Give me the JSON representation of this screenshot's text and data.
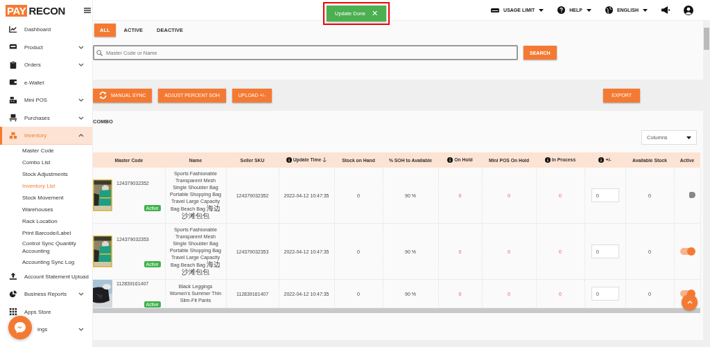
{
  "logo": {
    "part_1": "PAY",
    "part_2": "RECON"
  },
  "toast": {
    "text": "Update Done",
    "close": "✕"
  },
  "topbar": {
    "items": [
      {
        "label": "USAGE LIMIT",
        "kind": "storage"
      },
      {
        "label": "HELP",
        "kind": "help"
      },
      {
        "label": "ENGLISH",
        "kind": "globe"
      }
    ]
  },
  "sidebar": {
    "items": [
      {
        "label": "Dashboard",
        "expandable": false,
        "expanded": false,
        "selected": false
      },
      {
        "label": "Product",
        "expandable": true,
        "expanded": false,
        "selected": false
      },
      {
        "label": "Orders",
        "expandable": true,
        "expanded": false,
        "selected": false
      },
      {
        "label": "e-Wallet",
        "expandable": false,
        "expanded": false,
        "selected": false
      },
      {
        "label": "Mini POS",
        "expandable": true,
        "expanded": false,
        "selected": false
      },
      {
        "label": "Purchases",
        "expandable": true,
        "expanded": false,
        "selected": false
      },
      {
        "label": "Inventory",
        "expandable": true,
        "expanded": true,
        "selected": true,
        "children": [
          {
            "label": "Master Code",
            "selected": false
          },
          {
            "label": "Combo List",
            "selected": false
          },
          {
            "label": "Stock Adjustments",
            "selected": false
          },
          {
            "label": "Inventory List",
            "selected": true
          },
          {
            "label": "Stock Movement",
            "selected": false
          },
          {
            "label": "Warehouses",
            "selected": false
          },
          {
            "label": "Rack Location",
            "selected": false
          },
          {
            "label": "Print Barcode/Label",
            "selected": false
          },
          {
            "label": "Control Sync Quantity Accounting",
            "selected": false
          },
          {
            "label": "Accounting Sync Log",
            "selected": false
          }
        ]
      },
      {
        "label": "Account Statement Upload",
        "expandable": false,
        "expanded": false,
        "selected": false
      },
      {
        "label": "Business Reports",
        "expandable": true,
        "expanded": false,
        "selected": false
      },
      {
        "label": "Apps Store",
        "expandable": false,
        "expanded": false,
        "selected": false
      },
      {
        "label": "ings",
        "expandable": true,
        "expanded": false,
        "selected": false
      }
    ]
  },
  "tabs": [
    {
      "label": "ALL",
      "selected": true
    },
    {
      "label": "ACTIVE",
      "selected": false
    },
    {
      "label": "DEACTIVE",
      "selected": false
    }
  ],
  "search": {
    "placeholder": "Master Code or Name",
    "button": "SEARCH"
  },
  "actions": [
    {
      "label": "MANUAL SYNC",
      "kind": "sync"
    },
    {
      "label": "ADJUST PERCENT SOH",
      "kind": "plain"
    },
    {
      "label": "UPLOAD +/-",
      "kind": "plain"
    }
  ],
  "export": "EXPORT",
  "section_title": "COMBO",
  "columns_select": "Columns",
  "table": {
    "columns": [
      {
        "label": "Master Code",
        "info": false,
        "sorted": false
      },
      {
        "label": "Name",
        "info": false,
        "sorted": false
      },
      {
        "label": "Seller SKU",
        "info": false,
        "sorted": false
      },
      {
        "label": "Update Time",
        "info": true,
        "sorted": true
      },
      {
        "label": "Stock on Hand",
        "info": false,
        "sorted": false
      },
      {
        "label": "% SOH to Available",
        "info": false,
        "sorted": false
      },
      {
        "label": "On Hold",
        "info": true,
        "sorted": false
      },
      {
        "label": "Mini POS On Hold",
        "info": false,
        "sorted": false
      },
      {
        "label": "In Process",
        "info": true,
        "sorted": false
      },
      {
        "label": "+/-",
        "info": true,
        "sorted": false
      },
      {
        "label": "Available Stock",
        "info": false,
        "sorted": false
      },
      {
        "label": "Active",
        "info": false,
        "sorted": false
      }
    ],
    "rows": [
      {
        "master_code": "124379032352",
        "status": "Active",
        "name": "Sports Fashionable Transparent Mesh Single Shoulder Bag Portable Shopping Bag Travel Large Capacity Bag Beach Bag 海边沙滩包包",
        "seller_sku": "124379032352",
        "update_time": "2022-04-12 10:47:35",
        "stock_on_hand": "0",
        "soh_pct": "90 %",
        "on_hold": "0",
        "mini_pos_on_hold": "0",
        "in_process": "0",
        "adjust": "0",
        "available": "0",
        "active": false
      },
      {
        "master_code": "124379032353",
        "status": "Active",
        "name": "Sports Fashionable Transparent Mesh Single Shoulder Bag Portable Shopping Bag Travel Large Capacity Bag Beach Bag 海边沙滩包包",
        "seller_sku": "124379032353",
        "update_time": "2022-04-12 10:47:35",
        "stock_on_hand": "0",
        "soh_pct": "90 %",
        "on_hold": "0",
        "mini_pos_on_hold": "0",
        "in_process": "0",
        "adjust": "0",
        "available": "0",
        "active": true
      },
      {
        "master_code": "112839161407",
        "status": "Active",
        "name": "Black Leggings Women's Summer Thin Slim-Fit Pants",
        "seller_sku": "112839161407",
        "update_time": "2022-04-12 10:47:35",
        "stock_on_hand": "0",
        "soh_pct": "90 %",
        "on_hold": "0",
        "mini_pos_on_hold": "0",
        "in_process": "0",
        "adjust": "0",
        "available": "0",
        "active": true
      }
    ]
  }
}
